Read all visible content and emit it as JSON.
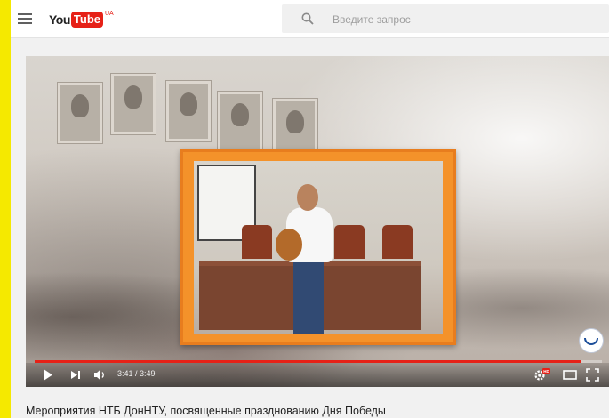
{
  "masthead": {
    "logo_you": "You",
    "logo_tube": "Tube",
    "logo_region": "UA",
    "search_placeholder": "Введите запрос"
  },
  "player": {
    "current_time": "3:41",
    "duration": "3:49",
    "time_display": "3:41 / 3:49",
    "progress_fraction": 0.964,
    "quality_badge": "HD",
    "controls": [
      "play-icon",
      "next-icon",
      "volume-icon",
      "settings-icon",
      "theater-mode-icon",
      "fullscreen-icon"
    ]
  },
  "video": {
    "title": "Мероприятия НТБ ДонНТУ, посвященные празднованию Дня Победы"
  },
  "colors": {
    "page_border": "#f5e900",
    "brand_red": "#e62117",
    "frame_orange": "#f4922a"
  }
}
